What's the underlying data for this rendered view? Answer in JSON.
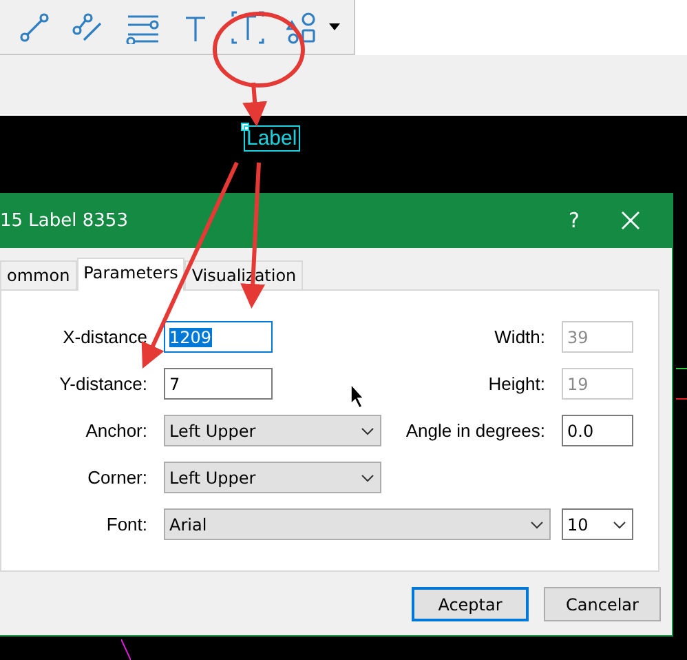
{
  "chart": {
    "object_label": "Label"
  },
  "dialog": {
    "title": "15 Label 8353",
    "help": "?",
    "tabs": [
      {
        "label": "ommon",
        "selected": false
      },
      {
        "label": "Parameters",
        "selected": true
      },
      {
        "label": "Visualization",
        "selected": false
      }
    ],
    "left_fields": [
      {
        "label": "X-distance",
        "kind": "input",
        "value": "1209",
        "focused": true
      },
      {
        "label": "Y-distance:",
        "kind": "input",
        "value": "7",
        "focused": false
      },
      {
        "label": "Anchor:",
        "kind": "select",
        "value": "Left Upper"
      },
      {
        "label": "Corner:",
        "kind": "select",
        "value": "Left Upper"
      }
    ],
    "right_fields": [
      {
        "label": "Width:",
        "value": "39",
        "disabled": true
      },
      {
        "label": "Height:",
        "value": "19",
        "disabled": true
      },
      {
        "label": "Angle in degrees:",
        "value": "0.0",
        "disabled": false
      }
    ],
    "font": {
      "label": "Font:",
      "value": "Arial",
      "size": "10"
    },
    "buttons": [
      {
        "label": "Aceptar",
        "default": true
      },
      {
        "label": "Cancelar",
        "default": false
      }
    ]
  }
}
